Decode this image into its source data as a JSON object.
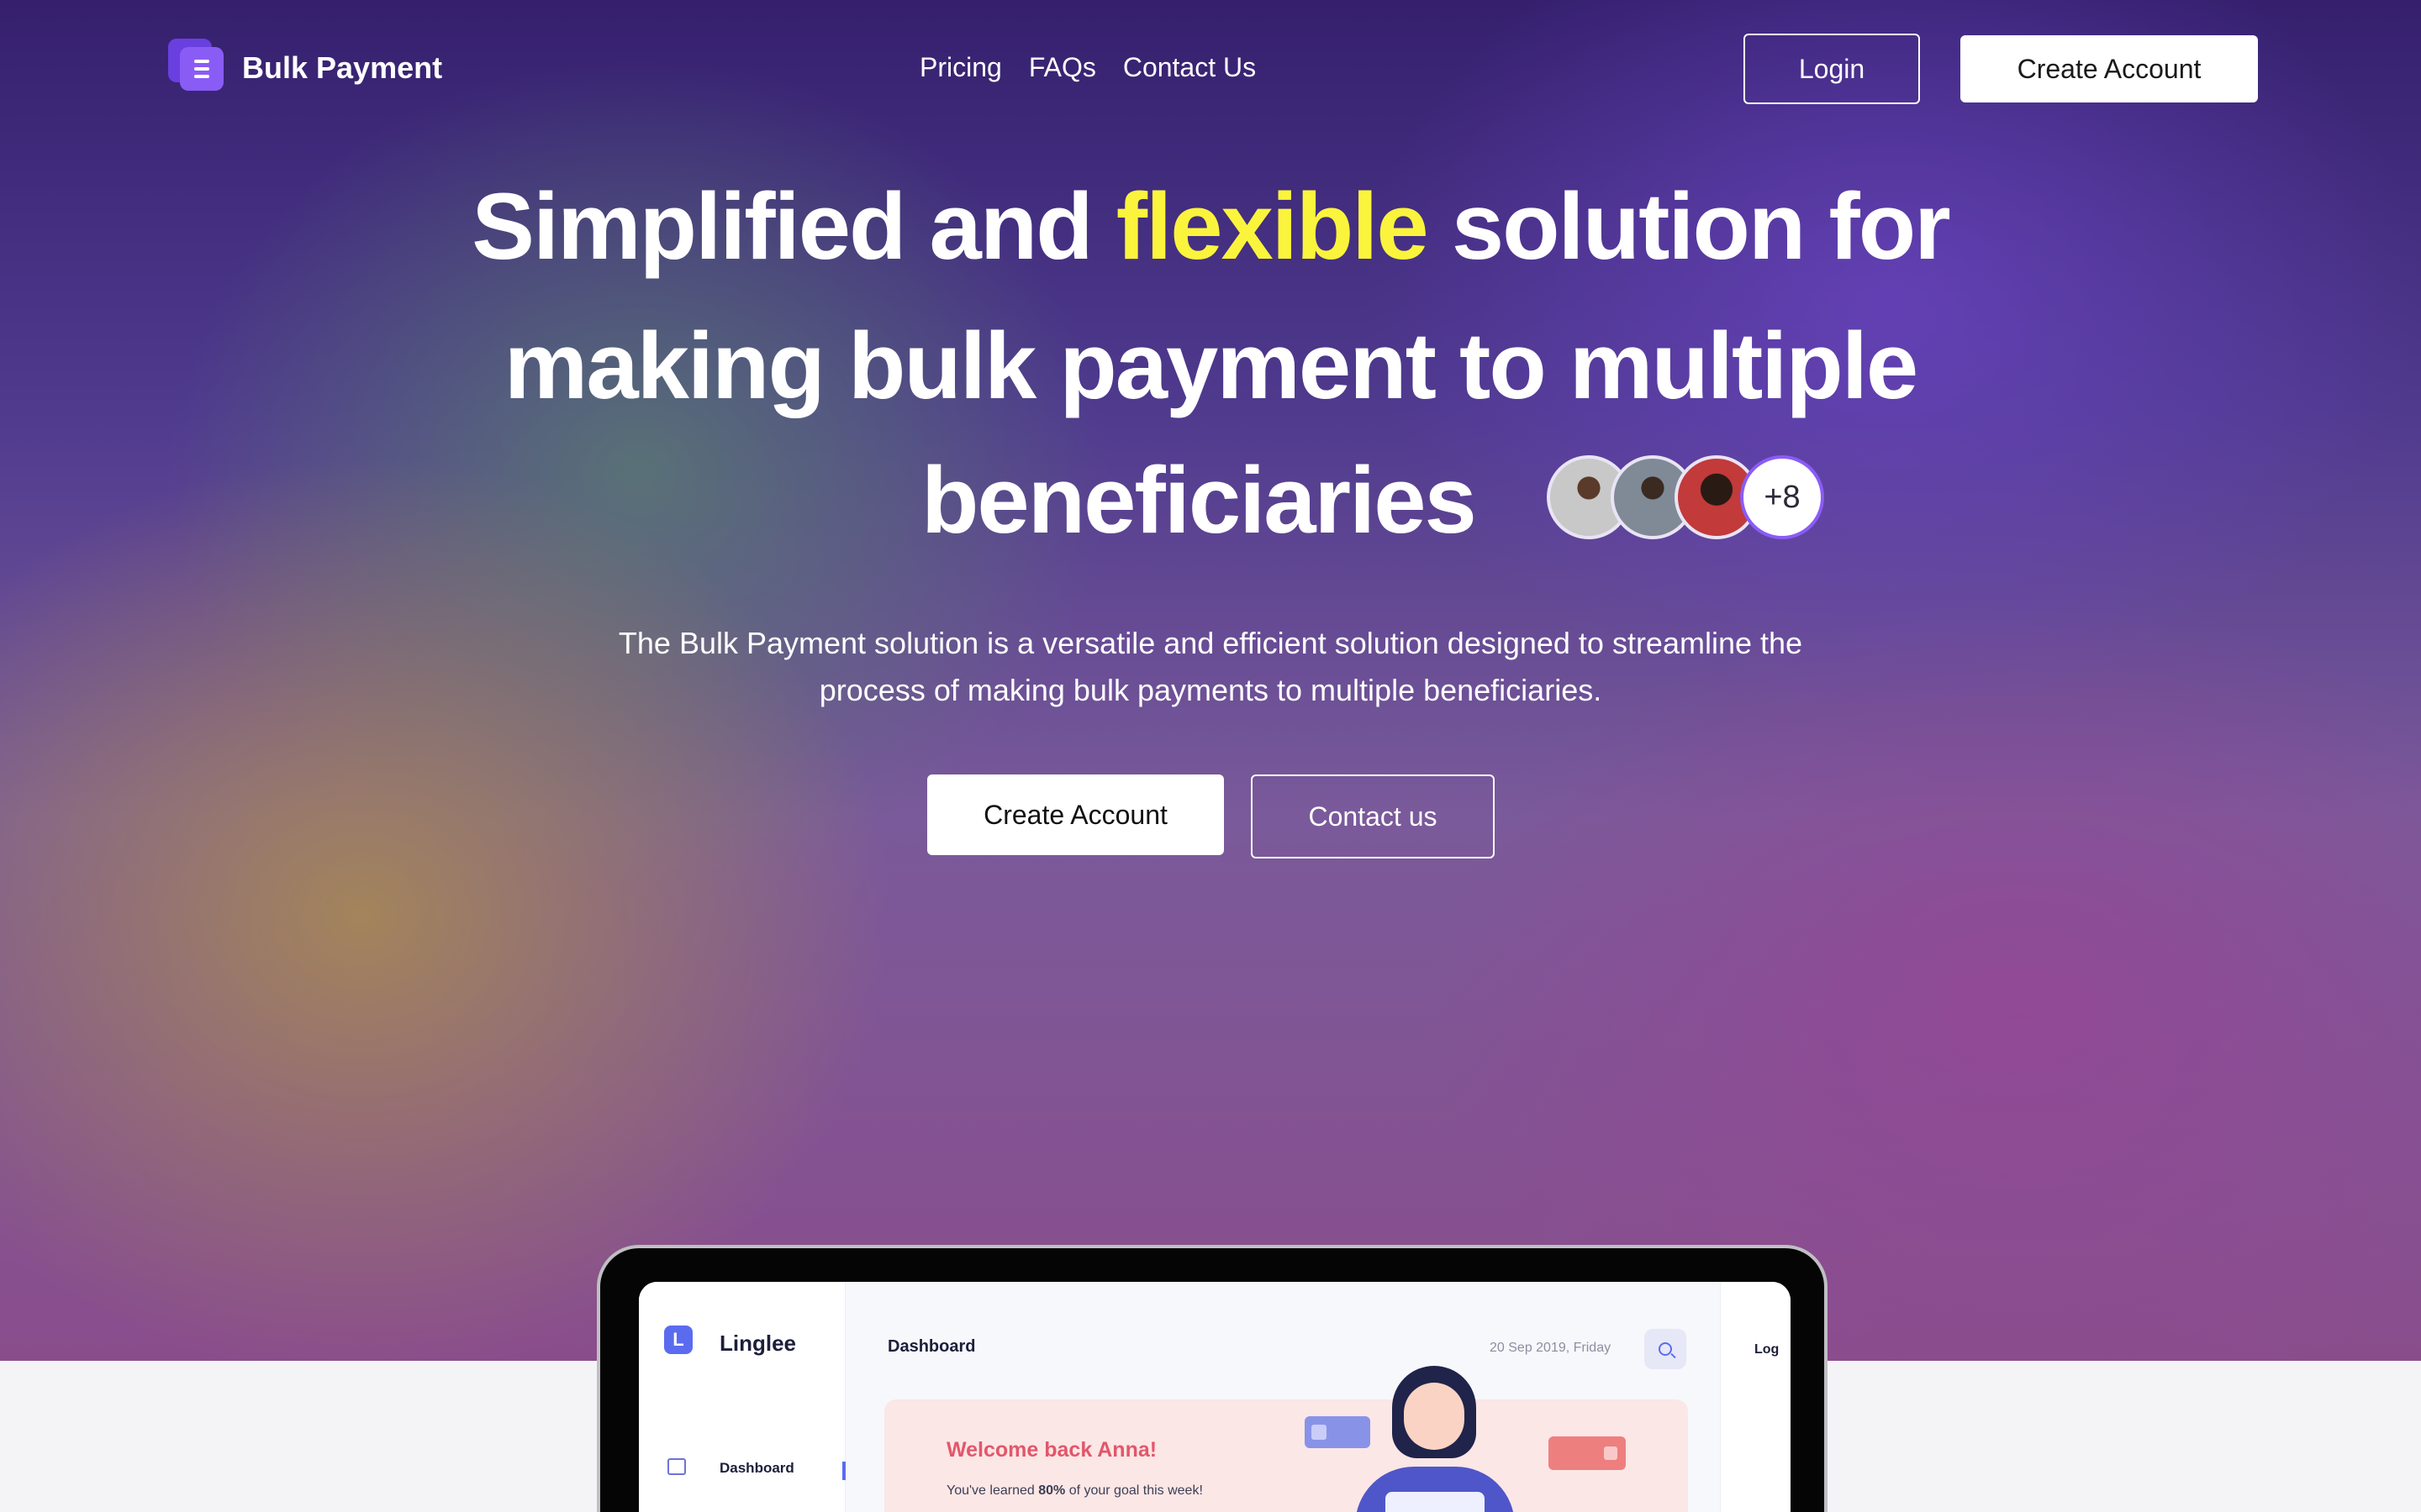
{
  "nav": {
    "brand": "Bulk Payment",
    "links": [
      "Pricing",
      "FAQs",
      "Contact Us"
    ],
    "login": "Login",
    "create_account": "Create Account"
  },
  "hero": {
    "line1_pre": "Simplified and",
    "line1_highlight": "flexible",
    "line1_post": "solution for",
    "line2": "making bulk payment to multiple",
    "line3": "beneficiaries",
    "avatar_more": "+8",
    "subtitle_line1": "The Bulk Payment solution is a versatile and efficient solution designed to streamline the",
    "subtitle_line2": "process of making bulk payments to multiple beneficiaries.",
    "cta_primary": "Create Account",
    "cta_secondary": "Contact us"
  },
  "preview": {
    "app_name": "Linglee",
    "sidebar_item": "Dashboard",
    "page_title": "Dashboard",
    "date": "20 Sep 2019, Friday",
    "welcome": "Welcome back Anna!",
    "progress_pre": "You've learned ",
    "progress_value": "80%",
    "progress_post": " of your goal this week!",
    "right_label": "Log"
  },
  "colors": {
    "accent": "#8a5cf6",
    "highlight": "#fbf43c",
    "welcome_text": "#e3566a"
  }
}
